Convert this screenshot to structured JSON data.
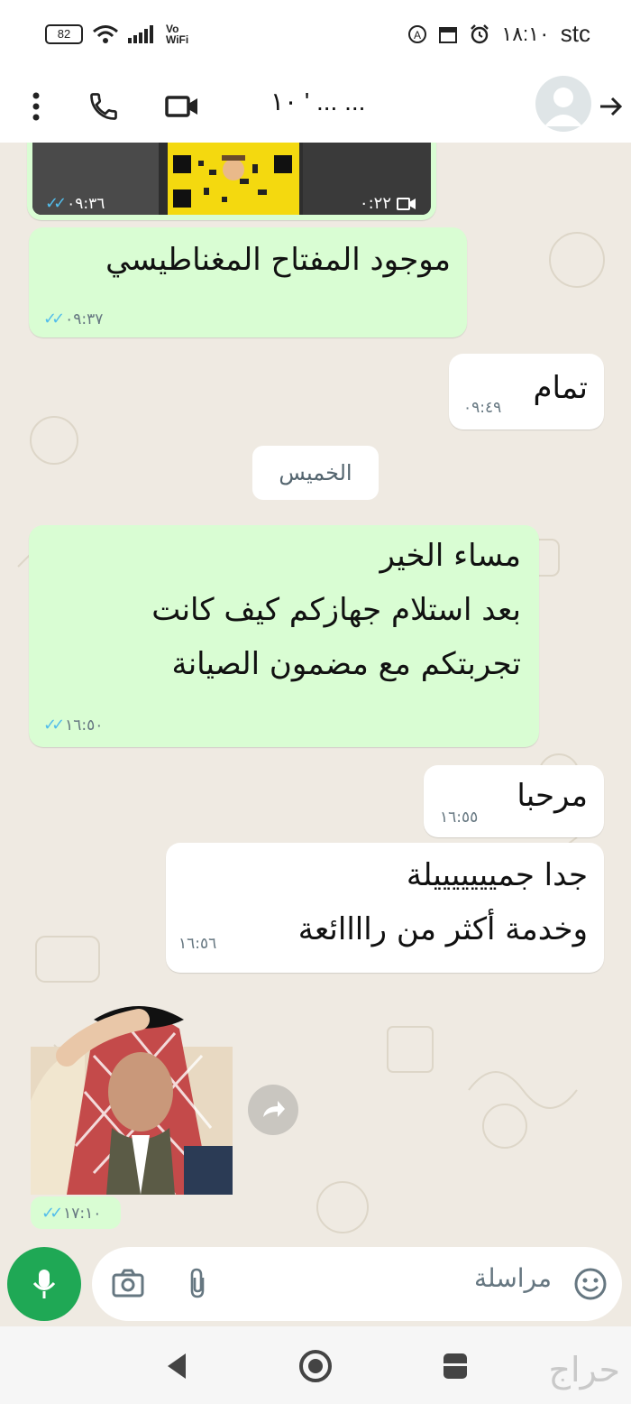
{
  "status_bar": {
    "battery": "82",
    "network_label_top": "Vo",
    "network_label_bottom": "WiFi",
    "time": "١٨:١٠",
    "carrier": "stc"
  },
  "header": {
    "contact_name": "١٠ ' ... ..."
  },
  "messages": {
    "video_thumb": {
      "duration": "٠:٢٢",
      "time": "٠٩:٣٦"
    },
    "m1": {
      "text": "موجود المفتاح المغناطيسي",
      "time": "٠٩:٣٧"
    },
    "m2": {
      "text": "تمام",
      "time": "٠٩:٤٩"
    },
    "date_separator": "الخميس",
    "m3": {
      "line1": "مساء الخير",
      "line2": "بعد استلام جهازكم كيف كانت",
      "line3": "تجربتكم مع مضمون الصيانة",
      "time": "١٦:٥٠"
    },
    "m4": {
      "text": "مرحبا",
      "time": "١٦:٥٥"
    },
    "m5": {
      "line1": "جدا جميييييييلة",
      "line2": "وخدمة أكثر من راااائعة",
      "time": "١٦:٥٦"
    },
    "sticker": {
      "time": "١٧:١٠"
    }
  },
  "input": {
    "placeholder": "مراسلة"
  },
  "watermark": "حراج",
  "colors": {
    "outgoing_bubble": "#d9fdd3",
    "incoming_bubble": "#ffffff",
    "chat_background": "#efeae2",
    "read_ticks": "#53bdeb",
    "mic_button": "#1fa855"
  },
  "icons": {
    "menu": "more-vert-icon",
    "call": "phone-icon",
    "video": "video-camera-icon",
    "back": "arrow-right-icon",
    "camera": "camera-icon",
    "attach": "paperclip-icon",
    "emoji": "emoji-icon",
    "mic": "microphone-icon",
    "forward": "forward-icon"
  }
}
